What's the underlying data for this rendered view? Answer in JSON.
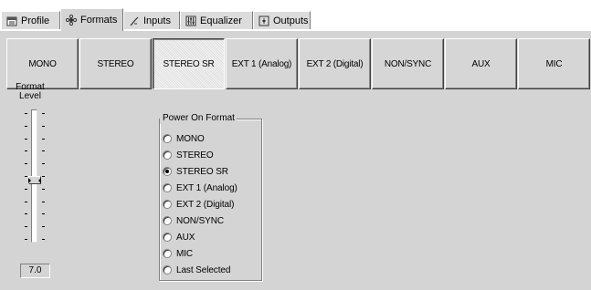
{
  "tabs": [
    {
      "label": "Profile",
      "icon": "profile-icon",
      "active": false
    },
    {
      "label": "Formats",
      "icon": "formats-icon",
      "active": true
    },
    {
      "label": "Inputs",
      "icon": "inputs-icon",
      "active": false
    },
    {
      "label": "Equalizer",
      "icon": "equalizer-icon",
      "active": false
    },
    {
      "label": "Outputs",
      "icon": "outputs-icon",
      "active": false
    }
  ],
  "formats": [
    {
      "label": "MONO",
      "pressed": false
    },
    {
      "label": "STEREO",
      "pressed": false
    },
    {
      "label": "STEREO SR",
      "pressed": true
    },
    {
      "label": "EXT 1 (Analog)",
      "pressed": false
    },
    {
      "label": "EXT 2 (Digital)",
      "pressed": false
    },
    {
      "label": "NON/SYNC",
      "pressed": false
    },
    {
      "label": "AUX",
      "pressed": false
    },
    {
      "label": "MIC",
      "pressed": false
    }
  ],
  "format_level": {
    "label_line1": "Format",
    "label_line2": "Level",
    "value": "7.0",
    "slider_fraction_from_top": 0.54
  },
  "power_on_format": {
    "title": "Power On Format",
    "options": [
      {
        "label": "MONO",
        "checked": false
      },
      {
        "label": "STEREO",
        "checked": false
      },
      {
        "label": "STEREO SR",
        "checked": true
      },
      {
        "label": "EXT 1 (Analog)",
        "checked": false
      },
      {
        "label": "EXT 2 (Digital)",
        "checked": false
      },
      {
        "label": "NON/SYNC",
        "checked": false
      },
      {
        "label": "AUX",
        "checked": false
      },
      {
        "label": "MIC",
        "checked": false
      },
      {
        "label": "Last Selected",
        "checked": false
      }
    ]
  }
}
